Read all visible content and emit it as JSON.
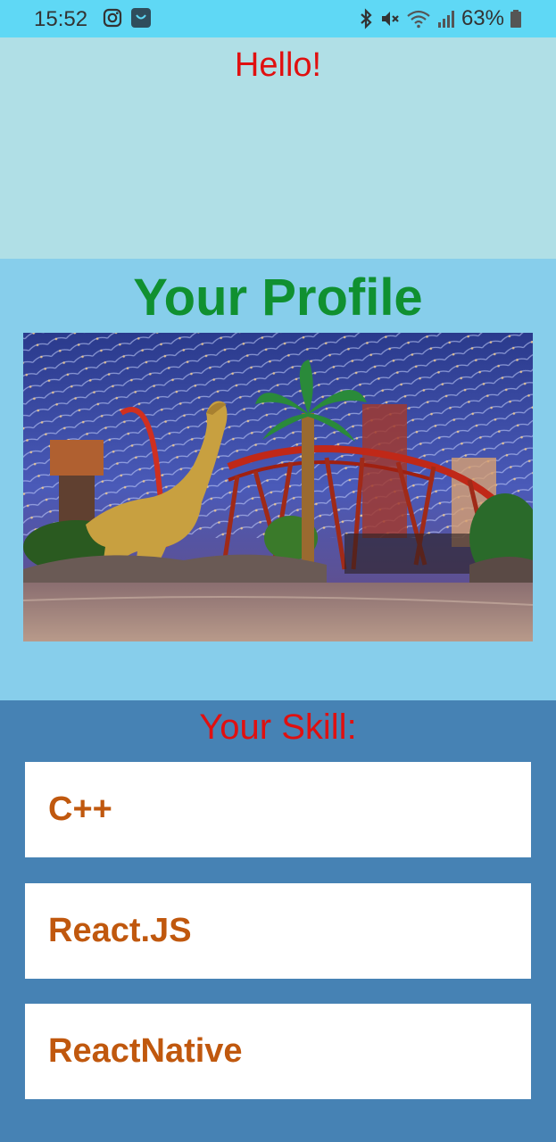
{
  "status_bar": {
    "time": "15:52",
    "battery": "63%",
    "icons": [
      "instagram-icon",
      "store-bag-icon",
      "bluetooth-icon",
      "mute-icon",
      "wifi-icon",
      "signal-icon",
      "battery-icon"
    ]
  },
  "greeting": {
    "text": "Hello!"
  },
  "profile": {
    "title": "Your Profile",
    "image_icon": "theme-park-photo"
  },
  "skills": {
    "title": "Your Skill:",
    "items": [
      "C++",
      "React.JS",
      "ReactNative"
    ]
  },
  "colors": {
    "status_bar": "#5fd8f5",
    "hello_bg": "#b0dfe6",
    "profile_bg": "#87ceeb",
    "skill_bg": "#4682b4",
    "red_text": "#e01010",
    "green_title": "#109030",
    "skill_text": "#c0580e"
  }
}
